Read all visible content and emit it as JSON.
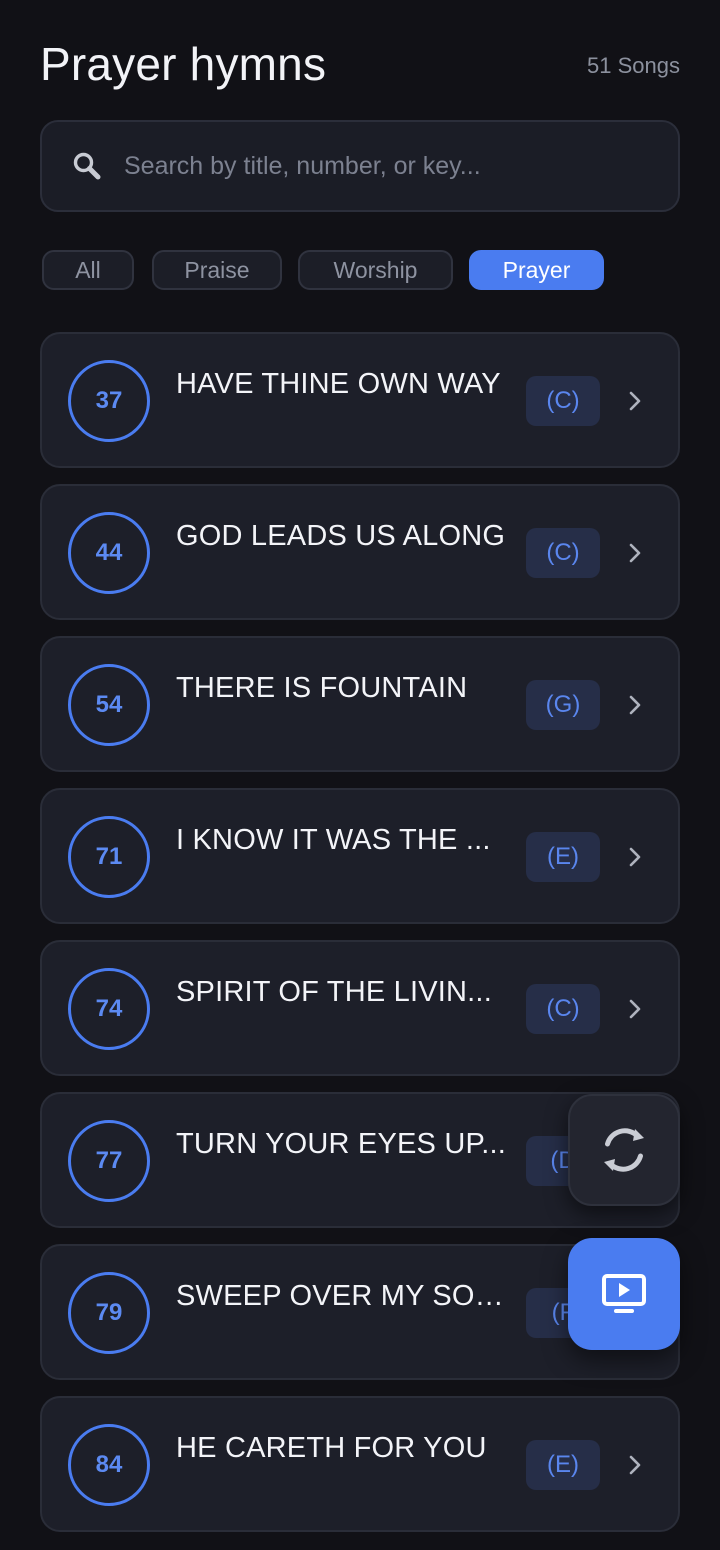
{
  "header": {
    "title": "Prayer hymns",
    "count": "51 Songs"
  },
  "search": {
    "placeholder": "Search by title, number, or key...",
    "value": ""
  },
  "filters": [
    {
      "label": "All",
      "active": false
    },
    {
      "label": "Praise",
      "active": false
    },
    {
      "label": "Worship",
      "active": false
    },
    {
      "label": "Prayer",
      "active": true
    }
  ],
  "songs": [
    {
      "number": "37",
      "title": "HAVE THINE OWN WAY",
      "key": "(C)"
    },
    {
      "number": "44",
      "title": "GOD LEADS US ALONG",
      "key": "(C)"
    },
    {
      "number": "54",
      "title": "THERE IS FOUNTAIN",
      "key": "(G)"
    },
    {
      "number": "71",
      "title": "I KNOW IT WAS THE ...",
      "key": "(E)"
    },
    {
      "number": "74",
      "title": "SPIRIT OF THE LIVIN...",
      "key": "(C)"
    },
    {
      "number": "77",
      "title": "TURN YOUR EYES UP...",
      "key": "(D"
    },
    {
      "number": "79",
      "title": "SWEEP OVER MY SOUL",
      "key": "(F"
    },
    {
      "number": "84",
      "title": "HE CARETH FOR YOU",
      "key": "(E)"
    }
  ],
  "icons": {
    "search": "search-icon",
    "chevron": "chevron-right-icon",
    "refresh": "refresh-icon",
    "present": "presentation-play-icon"
  },
  "colors": {
    "accent": "#4A7CF0",
    "background": "#111116",
    "card": "#1D1F29"
  }
}
